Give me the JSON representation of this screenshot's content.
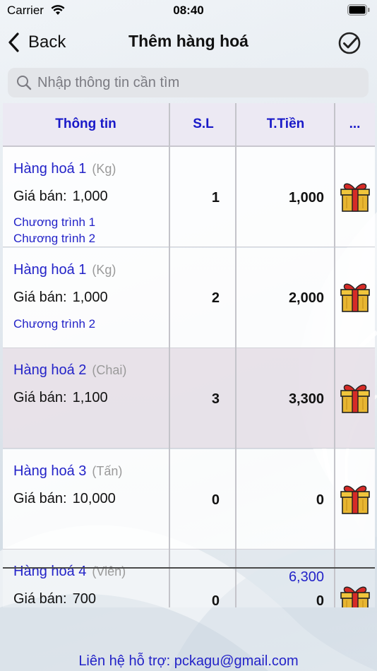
{
  "status": {
    "carrier": "Carrier",
    "time": "08:40"
  },
  "nav": {
    "back_label": "Back",
    "title": "Thêm hàng hoá"
  },
  "search": {
    "placeholder": "Nhập thông tin cần tìm",
    "value": ""
  },
  "table": {
    "headers": [
      "Thông tin",
      "S.L",
      "T.Tiền",
      "..."
    ],
    "price_label": "Giá bán:",
    "rows": [
      {
        "name": "Hàng hoá 1",
        "unit": "(Kg)",
        "price": "1,000",
        "qty": "1",
        "total": "1,000",
        "promos": [
          "Chương trình 1",
          "Chương trình 2"
        ]
      },
      {
        "name": "Hàng hoá 1",
        "unit": "(Kg)",
        "price": "1,000",
        "qty": "2",
        "total": "2,000",
        "promos": [
          "Chương trình 2"
        ]
      },
      {
        "name": "Hàng hoá 2",
        "unit": "(Chai)",
        "price": "1,100",
        "qty": "3",
        "total": "3,300",
        "promos": []
      },
      {
        "name": "Hàng hoá 3",
        "unit": "(Tấn)",
        "price": "10,000",
        "qty": "0",
        "total": "0",
        "promos": []
      },
      {
        "name": "Hàng hoá 4",
        "unit": "(Viên)",
        "price": "700",
        "qty": "0",
        "total": "0",
        "promos": []
      }
    ],
    "grand_total": "6,300"
  },
  "footer": {
    "contact": "Liên hệ hỗ trợ: pckagu@gmail.com"
  },
  "colors": {
    "accent": "#2323c8",
    "header_bg": "#ece9f3",
    "selected_row": "#e8e2e9",
    "gift_gold": "#e8b631",
    "gift_red": "#d62b27"
  }
}
